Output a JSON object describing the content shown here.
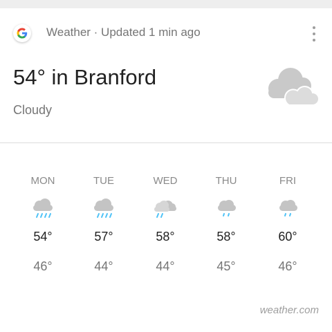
{
  "header": {
    "logo_icon": "google-g-icon",
    "text": "Weather · Updated 1 min ago",
    "menu_icon": "more-vert-icon"
  },
  "current": {
    "temp_location": "54° in Branford",
    "condition": "Cloudy",
    "icon": "cloudy-icon"
  },
  "forecast": [
    {
      "day": "MON",
      "icon": "rain-icon",
      "high": "54°",
      "low": "46°"
    },
    {
      "day": "TUE",
      "icon": "rain-icon",
      "high": "57°",
      "low": "44°"
    },
    {
      "day": "WED",
      "icon": "light-rain-icon",
      "high": "58°",
      "low": "44°"
    },
    {
      "day": "THU",
      "icon": "showers-icon",
      "high": "58°",
      "low": "45°"
    },
    {
      "day": "FRI",
      "icon": "showers-icon",
      "high": "60°",
      "low": "46°"
    }
  ],
  "source": "weather.com",
  "colors": {
    "cloud": "#c9c9c9",
    "rain": "#4fc3f7",
    "text_primary": "#212121",
    "text_secondary": "#757575"
  }
}
